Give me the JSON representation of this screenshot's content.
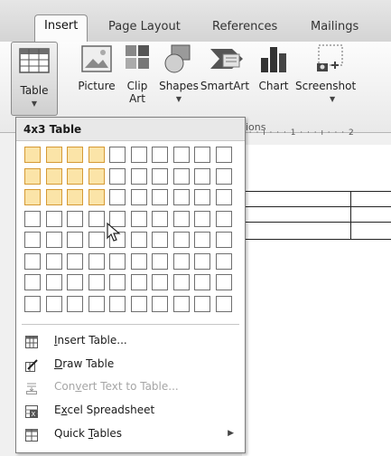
{
  "ribbon": {
    "tabs": [
      "Insert",
      "Page Layout",
      "References",
      "Mailings"
    ],
    "buttons": {
      "table": "Table",
      "picture": "Picture",
      "clip_art": "Clip Art",
      "shapes": "Shapes",
      "smartart": "SmartArt",
      "chart": "Chart",
      "screenshot": "Screenshot"
    },
    "group_label_partial": "ions"
  },
  "ruler": {
    "text": "· · · ı · · · 1 · · · ı · · · 2"
  },
  "dropdown": {
    "title": "4x3 Table",
    "grid": {
      "columns": 10,
      "rows": 8,
      "highlight_columns": 4,
      "highlight_rows": 3
    },
    "items": [
      {
        "label": "Insert Table...",
        "icon": "insert-table-icon",
        "disabled": false
      },
      {
        "label": "Draw Table",
        "icon": "draw-table-icon",
        "disabled": false
      },
      {
        "label": "Convert Text to Table...",
        "icon": "convert-text-icon",
        "disabled": true
      },
      {
        "label": "Excel Spreadsheet",
        "icon": "excel-icon",
        "disabled": false
      },
      {
        "label": "Quick Tables",
        "icon": "quick-tables-icon",
        "disabled": false,
        "submenu": true
      }
    ]
  },
  "colors": {
    "highlight_fill": "#fbe4a8",
    "highlight_border": "#d59a35"
  }
}
